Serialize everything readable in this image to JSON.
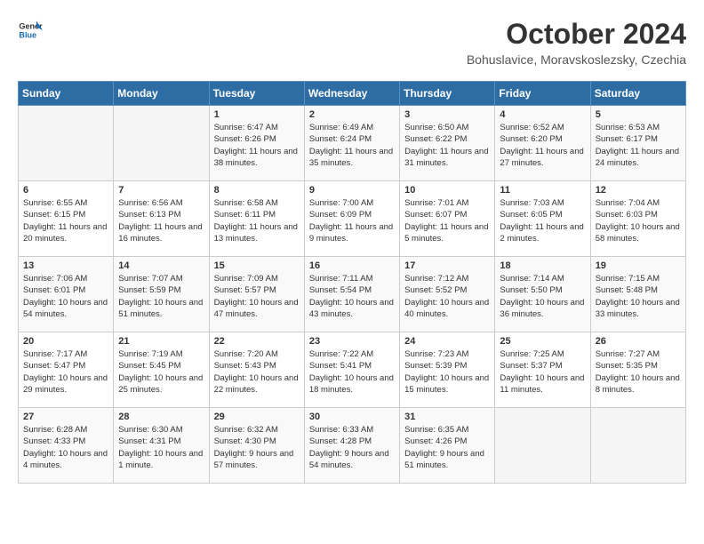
{
  "header": {
    "logo_general": "General",
    "logo_blue": "Blue",
    "month_title": "October 2024",
    "location": "Bohuslavice, Moravskoslezsky, Czechia"
  },
  "days_of_week": [
    "Sunday",
    "Monday",
    "Tuesday",
    "Wednesday",
    "Thursday",
    "Friday",
    "Saturday"
  ],
  "weeks": [
    [
      {
        "day": "",
        "empty": true
      },
      {
        "day": "",
        "empty": true
      },
      {
        "day": "1",
        "sunrise": "6:47 AM",
        "sunset": "6:26 PM",
        "daylight": "11 hours and 38 minutes."
      },
      {
        "day": "2",
        "sunrise": "6:49 AM",
        "sunset": "6:24 PM",
        "daylight": "11 hours and 35 minutes."
      },
      {
        "day": "3",
        "sunrise": "6:50 AM",
        "sunset": "6:22 PM",
        "daylight": "11 hours and 31 minutes."
      },
      {
        "day": "4",
        "sunrise": "6:52 AM",
        "sunset": "6:20 PM",
        "daylight": "11 hours and 27 minutes."
      },
      {
        "day": "5",
        "sunrise": "6:53 AM",
        "sunset": "6:17 PM",
        "daylight": "11 hours and 24 minutes."
      }
    ],
    [
      {
        "day": "6",
        "sunrise": "6:55 AM",
        "sunset": "6:15 PM",
        "daylight": "11 hours and 20 minutes."
      },
      {
        "day": "7",
        "sunrise": "6:56 AM",
        "sunset": "6:13 PM",
        "daylight": "11 hours and 16 minutes."
      },
      {
        "day": "8",
        "sunrise": "6:58 AM",
        "sunset": "6:11 PM",
        "daylight": "11 hours and 13 minutes."
      },
      {
        "day": "9",
        "sunrise": "7:00 AM",
        "sunset": "6:09 PM",
        "daylight": "11 hours and 9 minutes."
      },
      {
        "day": "10",
        "sunrise": "7:01 AM",
        "sunset": "6:07 PM",
        "daylight": "11 hours and 5 minutes."
      },
      {
        "day": "11",
        "sunrise": "7:03 AM",
        "sunset": "6:05 PM",
        "daylight": "11 hours and 2 minutes."
      },
      {
        "day": "12",
        "sunrise": "7:04 AM",
        "sunset": "6:03 PM",
        "daylight": "10 hours and 58 minutes."
      }
    ],
    [
      {
        "day": "13",
        "sunrise": "7:06 AM",
        "sunset": "6:01 PM",
        "daylight": "10 hours and 54 minutes."
      },
      {
        "day": "14",
        "sunrise": "7:07 AM",
        "sunset": "5:59 PM",
        "daylight": "10 hours and 51 minutes."
      },
      {
        "day": "15",
        "sunrise": "7:09 AM",
        "sunset": "5:57 PM",
        "daylight": "10 hours and 47 minutes."
      },
      {
        "day": "16",
        "sunrise": "7:11 AM",
        "sunset": "5:54 PM",
        "daylight": "10 hours and 43 minutes."
      },
      {
        "day": "17",
        "sunrise": "7:12 AM",
        "sunset": "5:52 PM",
        "daylight": "10 hours and 40 minutes."
      },
      {
        "day": "18",
        "sunrise": "7:14 AM",
        "sunset": "5:50 PM",
        "daylight": "10 hours and 36 minutes."
      },
      {
        "day": "19",
        "sunrise": "7:15 AM",
        "sunset": "5:48 PM",
        "daylight": "10 hours and 33 minutes."
      }
    ],
    [
      {
        "day": "20",
        "sunrise": "7:17 AM",
        "sunset": "5:47 PM",
        "daylight": "10 hours and 29 minutes."
      },
      {
        "day": "21",
        "sunrise": "7:19 AM",
        "sunset": "5:45 PM",
        "daylight": "10 hours and 25 minutes."
      },
      {
        "day": "22",
        "sunrise": "7:20 AM",
        "sunset": "5:43 PM",
        "daylight": "10 hours and 22 minutes."
      },
      {
        "day": "23",
        "sunrise": "7:22 AM",
        "sunset": "5:41 PM",
        "daylight": "10 hours and 18 minutes."
      },
      {
        "day": "24",
        "sunrise": "7:23 AM",
        "sunset": "5:39 PM",
        "daylight": "10 hours and 15 minutes."
      },
      {
        "day": "25",
        "sunrise": "7:25 AM",
        "sunset": "5:37 PM",
        "daylight": "10 hours and 11 minutes."
      },
      {
        "day": "26",
        "sunrise": "7:27 AM",
        "sunset": "5:35 PM",
        "daylight": "10 hours and 8 minutes."
      }
    ],
    [
      {
        "day": "27",
        "sunrise": "6:28 AM",
        "sunset": "4:33 PM",
        "daylight": "10 hours and 4 minutes."
      },
      {
        "day": "28",
        "sunrise": "6:30 AM",
        "sunset": "4:31 PM",
        "daylight": "10 hours and 1 minute."
      },
      {
        "day": "29",
        "sunrise": "6:32 AM",
        "sunset": "4:30 PM",
        "daylight": "9 hours and 57 minutes."
      },
      {
        "day": "30",
        "sunrise": "6:33 AM",
        "sunset": "4:28 PM",
        "daylight": "9 hours and 54 minutes."
      },
      {
        "day": "31",
        "sunrise": "6:35 AM",
        "sunset": "4:26 PM",
        "daylight": "9 hours and 51 minutes."
      },
      {
        "day": "",
        "empty": true
      },
      {
        "day": "",
        "empty": true
      }
    ]
  ]
}
